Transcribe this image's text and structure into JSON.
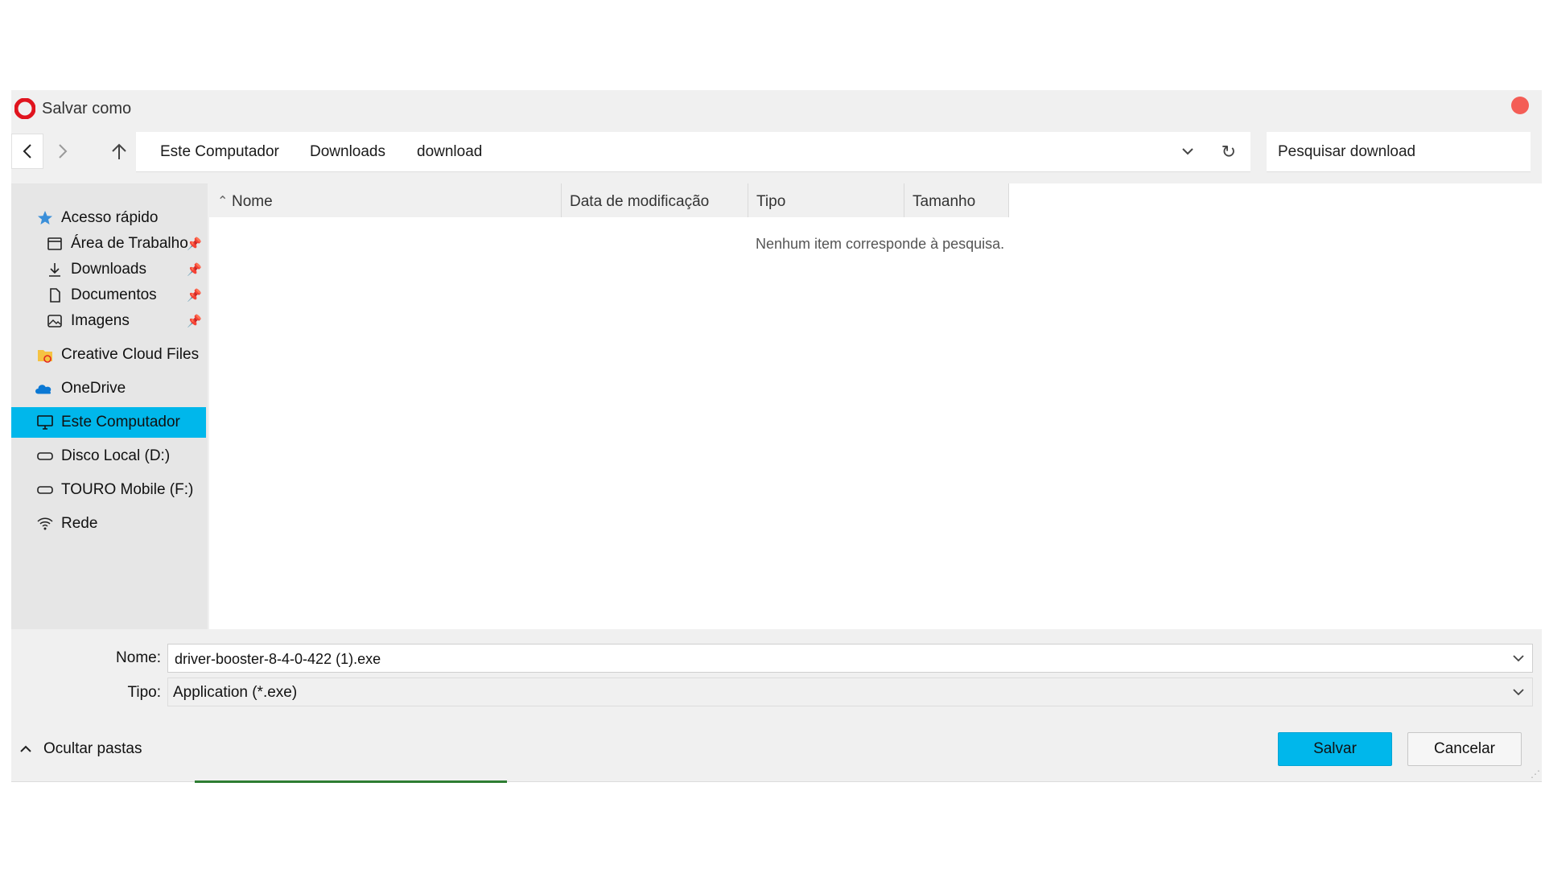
{
  "window": {
    "title": "Salvar como",
    "accent_color": "#00b7eb",
    "close_color": "#f45d56"
  },
  "nav": {
    "breadcrumbs": [
      "Este Computador",
      "Downloads",
      "download"
    ],
    "search_placeholder": "Pesquisar download",
    "icons": [
      "back-arrow-icon",
      "forward-arrow-icon",
      "up-arrow-icon",
      "chevron-down-icon",
      "refresh-icon"
    ]
  },
  "sidebar": {
    "items": [
      {
        "label": "Acesso rápido",
        "icon": "star-icon"
      },
      {
        "label": "Área de Trabalho",
        "icon": "desktop-icon",
        "pinned": true
      },
      {
        "label": "Downloads",
        "icon": "download-icon",
        "pinned": true
      },
      {
        "label": "Documentos",
        "icon": "document-icon",
        "pinned": true
      },
      {
        "label": "Imagens",
        "icon": "image-icon",
        "pinned": true
      },
      {
        "label": "Creative Cloud Files",
        "icon": "creative-cloud-folder-icon"
      },
      {
        "label": "OneDrive",
        "icon": "cloud-icon"
      },
      {
        "label": "Este Computador",
        "icon": "computer-icon",
        "selected": true
      },
      {
        "label": "Disco Local (D:)",
        "icon": "drive-icon"
      },
      {
        "label": "TOURO Mobile (F:)",
        "icon": "drive-icon"
      },
      {
        "label": "Rede",
        "icon": "network-icon"
      }
    ]
  },
  "file_list": {
    "columns": [
      "Nome",
      "Data de modificação",
      "Tipo",
      "Tamanho"
    ],
    "empty_message": "Nenhum item corresponde à pesquisa."
  },
  "form": {
    "name_label": "Nome:",
    "name_value": "driver-booster-8-4-0-422 (1).exe",
    "type_label": "Tipo:",
    "type_value": "Application (*.exe)"
  },
  "footer": {
    "toggle_folders_label": "Ocultar pastas",
    "save_label": "Salvar",
    "cancel_label": "Cancelar"
  }
}
